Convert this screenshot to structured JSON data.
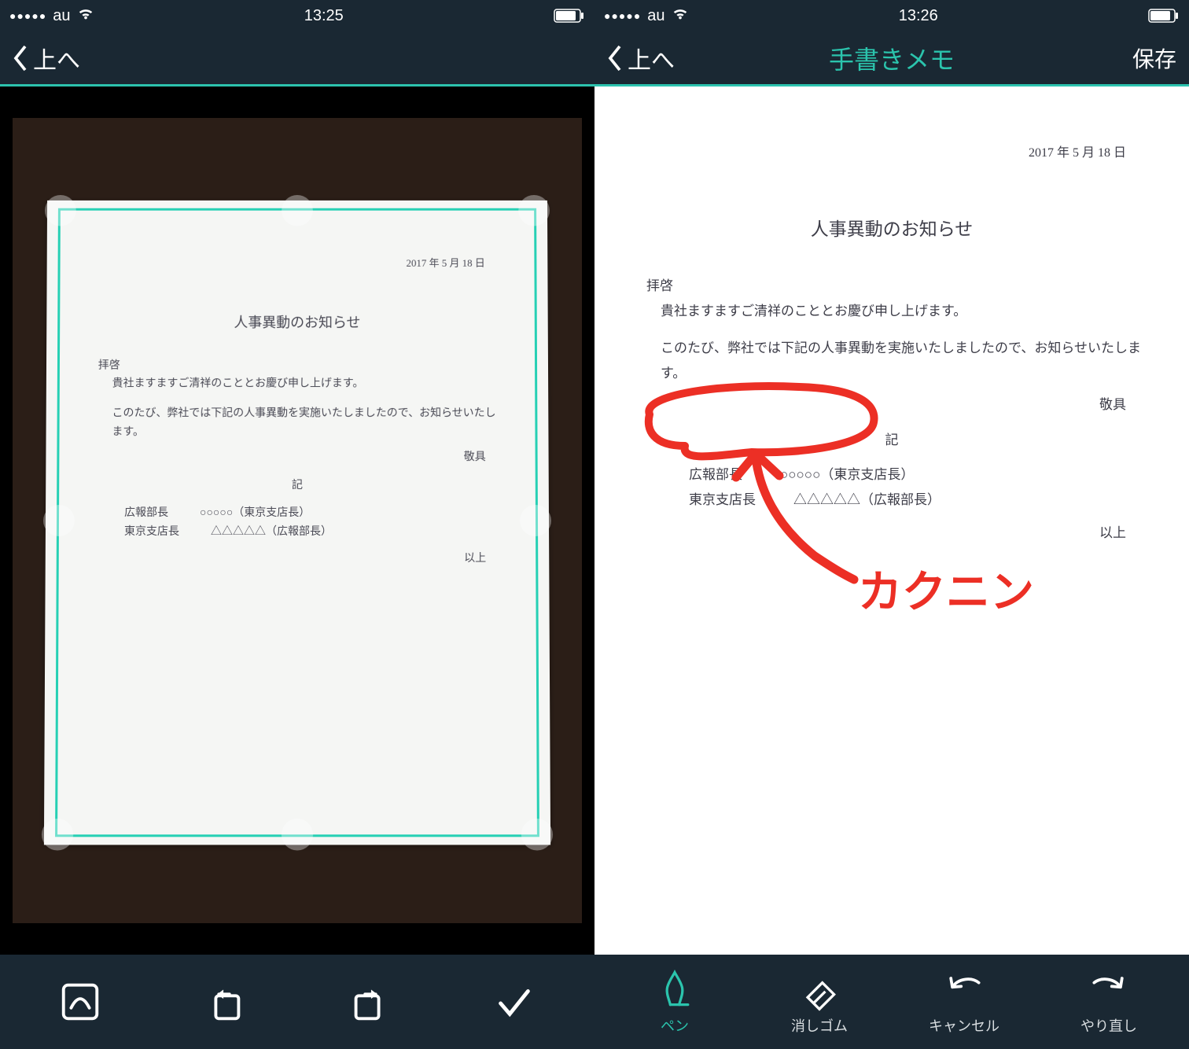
{
  "left": {
    "status": {
      "carrier": "au",
      "time": "13:25",
      "signal": "●●●●●"
    },
    "nav": {
      "back": "上へ"
    },
    "doc": {
      "date": "2017 年 5 月 18 日",
      "title": "人事異動のお知らせ",
      "greeting": "拝啓",
      "greeting_body": "貴社ますますご清祥のこととお慶び申し上げます。",
      "body": "このたび、弊社では下記の人事異動を実施いたしましたので、お知らせいたします。",
      "closing": "敬具",
      "subheader": "記",
      "rows": [
        {
          "role": "広報部長",
          "person": "○○○○○（東京支店長）"
        },
        {
          "role": "東京支店長",
          "person": "△△△△△（広報部長）"
        }
      ],
      "footer_right": "以上"
    },
    "toolbar": [
      {
        "name": "auto-crop",
        "label": ""
      },
      {
        "name": "rotate-left",
        "label": ""
      },
      {
        "name": "rotate-right",
        "label": ""
      },
      {
        "name": "confirm",
        "label": ""
      }
    ]
  },
  "right": {
    "status": {
      "carrier": "au",
      "time": "13:26",
      "signal": "●●●●●"
    },
    "nav": {
      "back": "上へ",
      "title": "手書きメモ",
      "save": "保存"
    },
    "doc": {
      "date": "2017 年 5 月 18 日",
      "title": "人事異動のお知らせ",
      "greeting": "拝啓",
      "greeting_body": "貴社ますますご清祥のこととお慶び申し上げます。",
      "body": "このたび、弊社では下記の人事異動を実施いたしましたので、お知らせいたします。",
      "closing": "敬具",
      "subheader": "記",
      "rows": [
        {
          "role": "広報部長",
          "person": "○○○○○（東京支店長）"
        },
        {
          "role": "東京支店長",
          "person": "△△△△△（広報部長）"
        }
      ],
      "footer_right": "以上"
    },
    "annotation_text": "カクニン",
    "toolbar": [
      {
        "name": "pen",
        "label": "ペン",
        "active": true
      },
      {
        "name": "eraser",
        "label": "消しゴム",
        "active": false
      },
      {
        "name": "cancel",
        "label": "キャンセル",
        "active": false
      },
      {
        "name": "redo",
        "label": "やり直し",
        "active": false
      }
    ]
  },
  "colors": {
    "accent": "#2bc4ad",
    "bg_dark": "#1a2833",
    "annotation": "#ec2f25"
  }
}
